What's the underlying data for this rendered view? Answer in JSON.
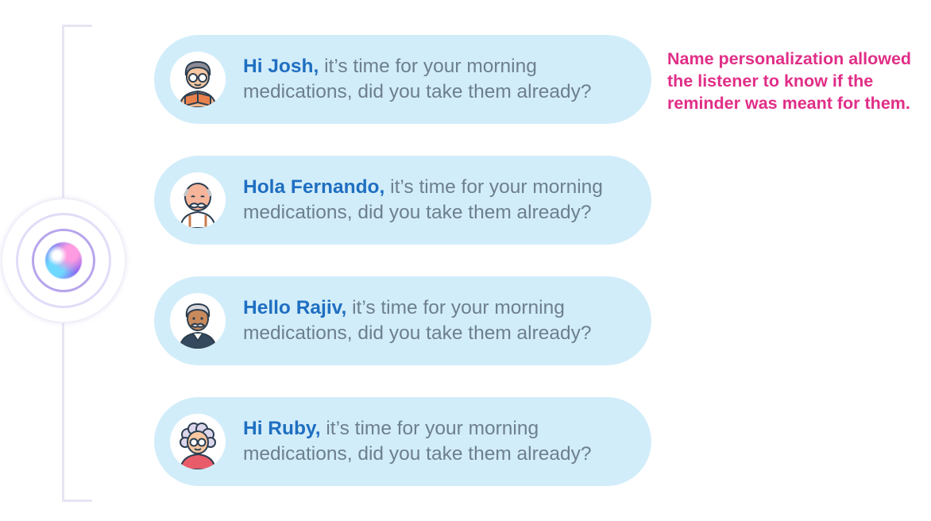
{
  "messages": [
    {
      "greeting": "Hi Josh,",
      "text": " it’s time for your morning medications, did you take them already?",
      "avatar": "man-glasses-reading-icon"
    },
    {
      "greeting": "Hola Fernando,",
      "text": " it’s time for your morning medications, did you take them already?",
      "avatar": "bald-man-mustache-icon"
    },
    {
      "greeting": "Hello Rajiv,",
      "text": " it’s time for your morning medications, did you take them already?",
      "avatar": "man-gray-hair-mustache-icon"
    },
    {
      "greeting": "Hi Ruby,",
      "text": " it’s time for your morning medications, did you take them already?",
      "avatar": "woman-curly-gray-hair-icon"
    }
  ],
  "annotation": "Name personalization allowed the listener to know if the reminder was meant for them.",
  "colors": {
    "bubble": "#d2edfa",
    "name": "#1f6fc1",
    "body_text": "#6d7f8d",
    "annotation": "#e02e87",
    "bracket": "#e5e5f4"
  },
  "orb_icon": "voice-assistant-orb-icon"
}
